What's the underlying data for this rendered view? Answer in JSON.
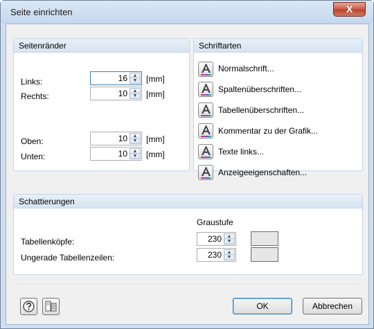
{
  "window": {
    "title": "Seite einrichten",
    "close_glyph": "X"
  },
  "margins": {
    "heading": "Seitenränder",
    "unit": "[mm]",
    "fields": [
      {
        "label": "Links:",
        "value": "16"
      },
      {
        "label": "Rechts:",
        "value": "10"
      },
      {
        "label": "Oben:",
        "value": "10"
      },
      {
        "label": "Unten:",
        "value": "10"
      }
    ]
  },
  "fonts": {
    "heading": "Schriftarten",
    "items": [
      "Normalschrift...",
      "Spaltenüberschriften...",
      "Tabellenüberschriften...",
      "Kommentar zu der Grafik...",
      "Texte links...",
      "Anzeigeeigenschaften..."
    ]
  },
  "shading": {
    "heading": "Schattierungen",
    "column_header": "Graustufe",
    "rows": [
      {
        "label": "Tabellenköpfe:",
        "value": "230",
        "swatch": "#e6e6e6"
      },
      {
        "label": "Ungerade Tabellenzeilen:",
        "value": "230",
        "swatch": "#e6e6e6"
      }
    ]
  },
  "footer": {
    "ok": "OK",
    "cancel": "Abbrechen"
  },
  "icons": {
    "help": "help-icon",
    "page_setup": "page-setup-icon",
    "font": "font-icon"
  },
  "colors": {
    "accent": "#3c7fb1",
    "group_header": "#d6e3f2",
    "close": "#c75a46"
  }
}
